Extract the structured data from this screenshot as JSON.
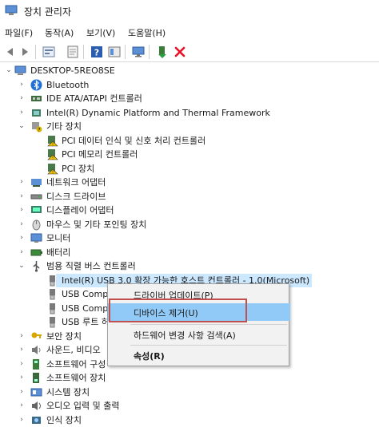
{
  "window": {
    "title": "장치 관리자"
  },
  "menu": [
    "파일(F)",
    "동작(A)",
    "보기(V)",
    "도움말(H)"
  ],
  "toolbar": {
    "icons": [
      "back-arrow-icon",
      "forward-arrow-icon",
      "properties-icon",
      "doc-icon",
      "help-icon",
      "panel-icon",
      "monitor-icon",
      "enable-device-icon",
      "remove-icon"
    ]
  },
  "tree": {
    "root": "DESKTOP-5REO8SE",
    "items": [
      {
        "label": "Bluetooth",
        "icon": "bluetooth-icon",
        "level": 1,
        "arrow": "›"
      },
      {
        "label": "IDE ATA/ATAPI 컨트롤러",
        "icon": "ide-controller-icon",
        "level": 1,
        "arrow": "›"
      },
      {
        "label": "Intel(R) Dynamic Platform and Thermal Framework",
        "icon": "chip-icon",
        "level": 1,
        "arrow": "›"
      },
      {
        "label": "기타 장치",
        "icon": "other-devices-icon",
        "level": 1,
        "arrow": "⌄"
      },
      {
        "label": "PCI 데이터 인식 및 신호 처리 컨트롤러",
        "icon": "warning-device-icon",
        "level": 2,
        "arrow": ""
      },
      {
        "label": "PCI 메모리 컨트롤러",
        "icon": "warning-device-icon",
        "level": 2,
        "arrow": ""
      },
      {
        "label": "PCI 장치",
        "icon": "warning-device-icon",
        "level": 2,
        "arrow": ""
      },
      {
        "label": "네트워크 어댑터",
        "icon": "network-adapter-icon",
        "level": 1,
        "arrow": "›"
      },
      {
        "label": "디스크 드라이브",
        "icon": "disk-drive-icon",
        "level": 1,
        "arrow": "›"
      },
      {
        "label": "디스플레이 어댑터",
        "icon": "display-adapter-icon",
        "level": 1,
        "arrow": "›"
      },
      {
        "label": "마우스 및 기타 포인팅 장치",
        "icon": "mouse-icon",
        "level": 1,
        "arrow": "›"
      },
      {
        "label": "모니터",
        "icon": "monitor-icon",
        "level": 1,
        "arrow": "›"
      },
      {
        "label": "배터리",
        "icon": "battery-icon",
        "level": 1,
        "arrow": "›"
      },
      {
        "label": "범용 직렬 버스 컨트롤러",
        "icon": "usb-icon",
        "level": 1,
        "arrow": "⌄"
      },
      {
        "label": "Intel(R) USB 3.0 확장 가능한 호스트 컨트롤러 - 1.0(Microsoft)",
        "icon": "usb-device-icon",
        "level": 2,
        "arrow": "",
        "selected": true
      },
      {
        "label": "USB Compo",
        "icon": "usb-device-icon",
        "level": 2,
        "arrow": ""
      },
      {
        "label": "USB Compo",
        "icon": "usb-device-icon",
        "level": 2,
        "arrow": ""
      },
      {
        "label": "USB 루트 허",
        "icon": "usb-device-icon",
        "level": 2,
        "arrow": ""
      },
      {
        "label": "보안 장치",
        "icon": "security-key-icon",
        "level": 1,
        "arrow": "›"
      },
      {
        "label": "사운드, 비디오",
        "icon": "sound-icon",
        "level": 1,
        "arrow": "›"
      },
      {
        "label": "소프트웨어 구성",
        "icon": "software-component-icon",
        "level": 1,
        "arrow": "›"
      },
      {
        "label": "소프트웨어 장치",
        "icon": "software-device-icon",
        "level": 1,
        "arrow": "›"
      },
      {
        "label": "시스템 장치",
        "icon": "system-device-icon",
        "level": 1,
        "arrow": "›"
      },
      {
        "label": "오디오 입력 및 출력",
        "icon": "audio-io-icon",
        "level": 1,
        "arrow": "›"
      },
      {
        "label": "인식 장치",
        "icon": "sensor-icon",
        "level": 1,
        "arrow": "›"
      }
    ]
  },
  "context_menu": {
    "items": [
      {
        "label": "드라이버 업데이트(P)",
        "bold": false
      },
      {
        "label": "디바이스 제거(U)",
        "bold": false,
        "hover": true
      },
      {
        "label": "하드웨어 변경 사항 검색(A)",
        "bold": false
      },
      {
        "label": "속성(R)",
        "bold": true
      }
    ]
  },
  "colors": {
    "selection": "#cce8ff",
    "menu_hover": "#91c9f7",
    "highlight_box": "#c0504d",
    "remove_red": "#e81123",
    "warning_yellow": "#f2c200"
  }
}
